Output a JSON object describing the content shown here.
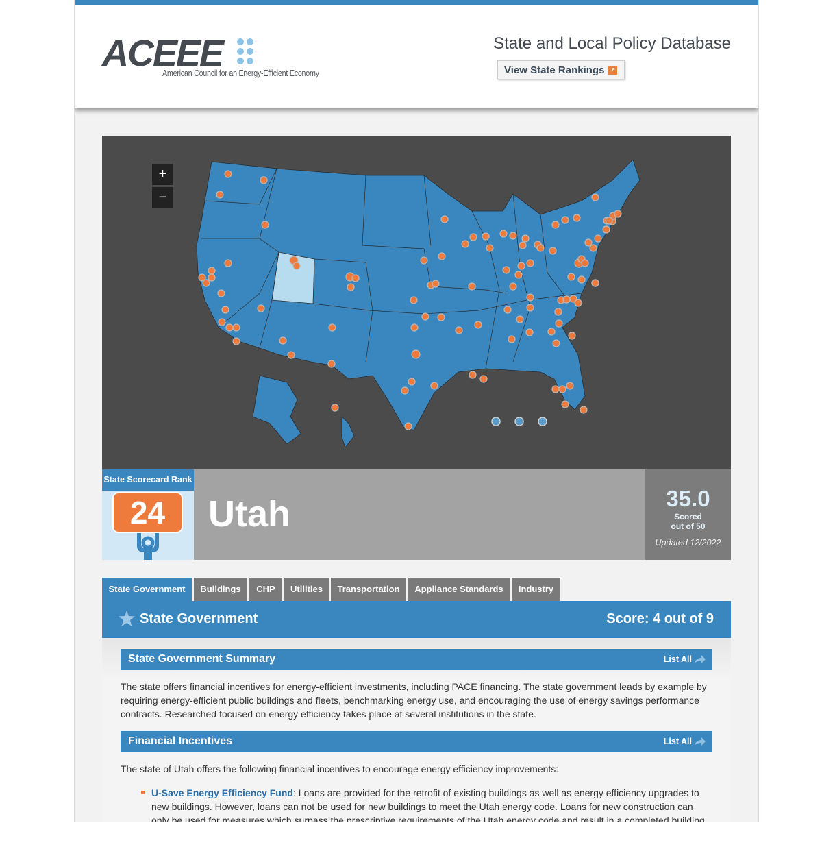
{
  "header": {
    "logo_text": "ACEEE",
    "logo_tagline": "American Council for an Energy-Efficient Economy",
    "db_title": "State and Local Policy Database",
    "rankings_button": "View State Rankings"
  },
  "map": {
    "zoom_in": "+",
    "zoom_out": "−",
    "selected_state": "Utah",
    "colors": {
      "land": "#3a87c0",
      "selected": "#b7dcf0",
      "marker": "#ee7b3b",
      "ocean": "#4b4b4b"
    }
  },
  "scorecard": {
    "rank_label": "State Scorecard Rank",
    "rank": "24",
    "state": "Utah",
    "score": "35.0",
    "scored_out_of": "Scored out of 50",
    "updated": "Updated 12/2022"
  },
  "tabs": [
    "State Government",
    "Buildings",
    "CHP",
    "Utilities",
    "Transportation",
    "Appliance Standards",
    "Industry"
  ],
  "section": {
    "title": "State Government",
    "score": "Score: 4 out of 9"
  },
  "summary": {
    "title": "State Government Summary",
    "list_all": "List All",
    "text": "The state offers financial incentives for energy-efficient investments, including PACE financing. The state government leads by example by requiring energy-efficient public buildings and fleets, benchmarking energy use, and encouraging the use of energy savings performance contracts. Researched focused on energy efficiency takes place at several institutions in the state."
  },
  "incentives": {
    "title": "Financial Incentives",
    "list_all": "List All",
    "intro": "The state of Utah offers the following financial incentives to encourage energy efficiency improvements:",
    "item_link": "U-Save Energy Efficiency Fund",
    "item_text": ": Loans are provided for the retrofit of existing buildings as well as energy efficiency upgrades to new buildings. However, loans can not be used for new buildings to meet the Utah energy code. Loans for new construction can only be used for measures which surpass the prescriptive requirements of the Utah energy code and result in a completed building"
  }
}
